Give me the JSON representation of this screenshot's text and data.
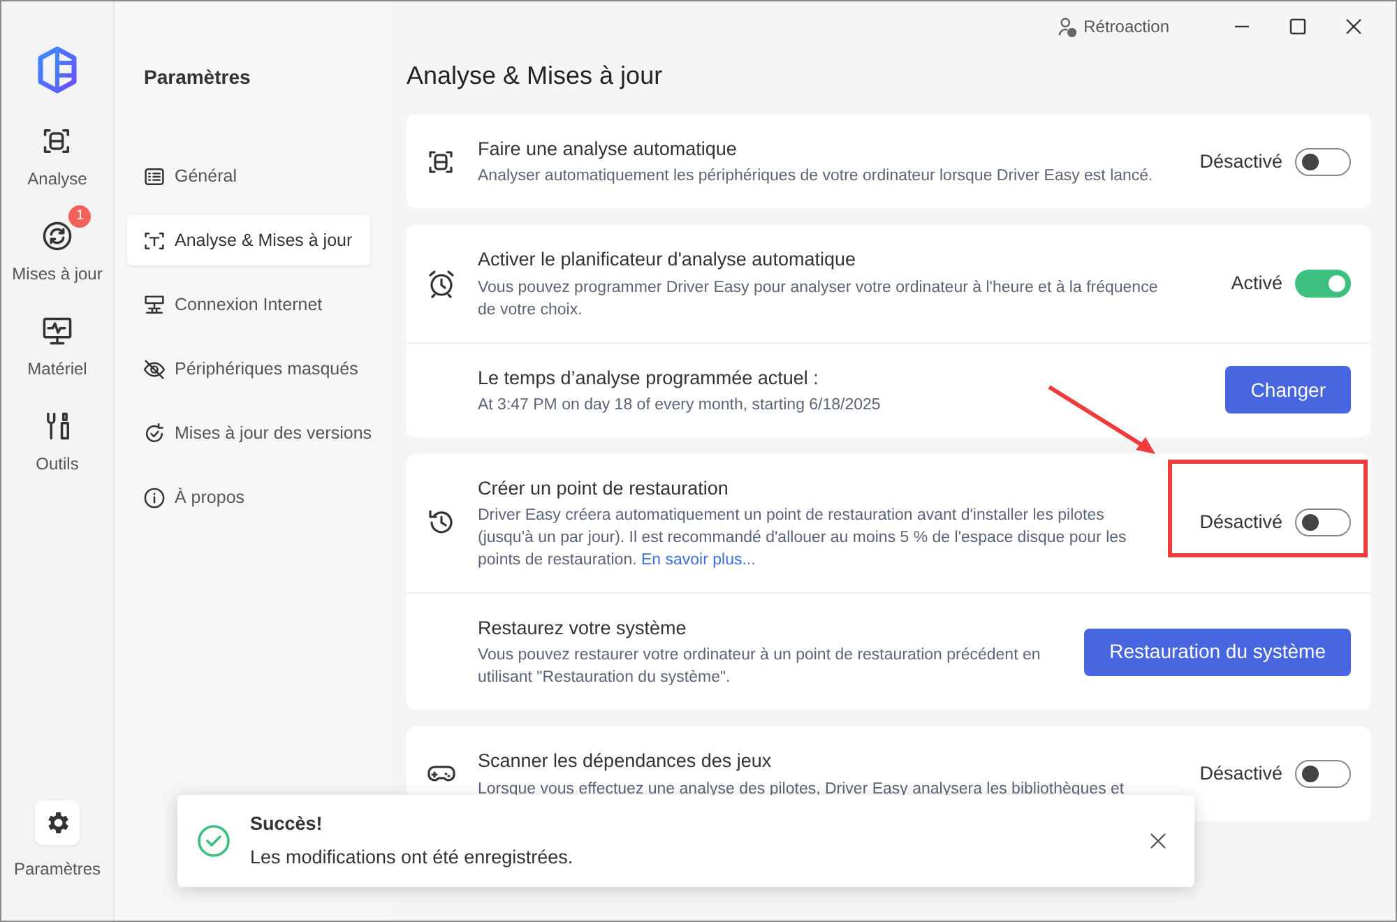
{
  "titlebar": {
    "feedback": "Rétroaction"
  },
  "rail": {
    "items": [
      {
        "label": "Analyse",
        "selected": false
      },
      {
        "label": "Mises à jour",
        "badge": "1",
        "selected": false
      },
      {
        "label": "Matériel",
        "selected": false
      },
      {
        "label": "Outils",
        "selected": false
      }
    ],
    "bottom": {
      "label": "Paramètres",
      "selected": true
    }
  },
  "nav": {
    "title": "Paramètres",
    "items": [
      {
        "label": "Général",
        "selected": false
      },
      {
        "label": "Analyse & Mises à jour",
        "selected": true
      },
      {
        "label": "Connexion Internet",
        "selected": false
      },
      {
        "label": "Périphériques masqués",
        "selected": false
      },
      {
        "label": "Mises à jour des versions",
        "selected": false
      },
      {
        "label": "À propos",
        "selected": false
      }
    ]
  },
  "page_title": "Analyse & Mises à jour",
  "cards": [
    {
      "rows": [
        {
          "kind": "toggle",
          "title": "Faire une analyse automatique",
          "description": "Analyser automatiquement les périphériques de votre ordinateur lorsque Driver Easy est lancé.",
          "state_label": "Désactivé",
          "on": false
        }
      ]
    },
    {
      "rows": [
        {
          "kind": "toggle",
          "title": "Activer le planificateur d'analyse automatique",
          "description": "Vous pouvez programmer Driver Easy pour analyser votre ordinateur à l'heure et à la fréquence de votre choix.",
          "state_label": "Activé",
          "on": true
        },
        {
          "kind": "button",
          "title": "Le temps d’analyse programmée actuel :",
          "description": "At 3:47 PM on day 18 of every month, starting 6/18/2025",
          "button": "Changer"
        }
      ]
    },
    {
      "rows": [
        {
          "kind": "toggle",
          "title": "Créer un point de restauration",
          "description": "Driver Easy créera automatiquement un point de restauration avant d'installer les pilotes (jusqu'à un par jour). Il est recommandé d'allouer au moins 5 % de l'espace disque pour les points de restauration.",
          "link": "En savoir plus...",
          "state_label": "Désactivé",
          "on": false,
          "highlighted": true
        },
        {
          "kind": "button",
          "title": "Restaurez votre système",
          "description": "Vous pouvez restaurer votre ordinateur à un point de restauration précédent en utilisant \"Restauration du système\".",
          "button": "Restauration du système"
        }
      ]
    },
    {
      "rows": [
        {
          "kind": "toggle",
          "title": "Scanner les dépendances des jeux",
          "description": "Lorsque vous effectuez une analyse des pilotes, Driver Easy analysera les bibliothèques et",
          "state_label": "Désactivé",
          "on": false
        }
      ]
    }
  ],
  "toast": {
    "title": "Succès!",
    "message": "Les modifications ont été enregistrées."
  }
}
